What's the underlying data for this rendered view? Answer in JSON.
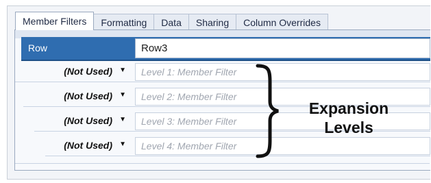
{
  "tabs": [
    {
      "label": "Member Filters",
      "active": true
    },
    {
      "label": "Formatting",
      "active": false
    },
    {
      "label": "Data",
      "active": false
    },
    {
      "label": "Sharing",
      "active": false
    },
    {
      "label": "Column Overrides",
      "active": false
    }
  ],
  "row": {
    "label": "Row",
    "value": "Row3"
  },
  "levels": [
    {
      "dropdown": "(Not Used)",
      "filter_placeholder": "Level 1: Member Filter"
    },
    {
      "dropdown": "(Not Used)",
      "filter_placeholder": "Level 2: Member Filter"
    },
    {
      "dropdown": "(Not Used)",
      "filter_placeholder": "Level 3: Member Filter"
    },
    {
      "dropdown": "(Not Used)",
      "filter_placeholder": "Level 4: Member Filter"
    }
  ],
  "annotation": {
    "line1": "Expansion",
    "line2": "Levels"
  },
  "icons": {
    "dropdown": "chevron-down-icon",
    "brace": "curly-brace-icon"
  },
  "colors": {
    "row_header": "#2f6db0",
    "panel": "#f7f9fc",
    "placeholder": "#a0a6b0"
  }
}
